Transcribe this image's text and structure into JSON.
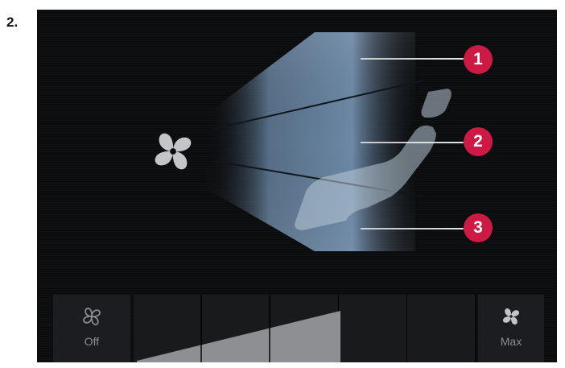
{
  "step_label": "2.",
  "badges": [
    "1",
    "2",
    "3"
  ],
  "fan_controls": {
    "off_label": "Off",
    "max_label": "Max",
    "off_icon": "fan-outline-icon",
    "max_icon": "fan-filled-icon",
    "levels_total": 5,
    "levels_filled": 3
  },
  "colors": {
    "badge": "#cc1a44",
    "screen_bg": "#0b0c0e",
    "airflow": "#8fb3d6",
    "level_fill": "#8d8f92"
  }
}
